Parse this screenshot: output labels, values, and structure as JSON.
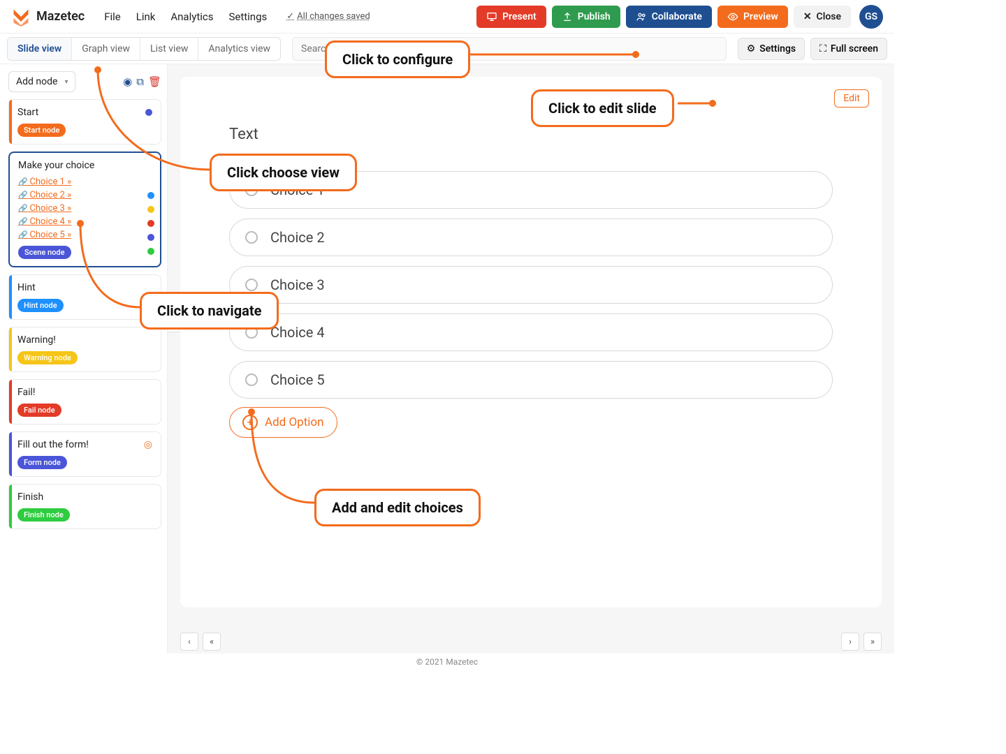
{
  "brand": "Mazetec",
  "menu": {
    "file": "File",
    "link": "Link",
    "analytics": "Analytics",
    "settings": "Settings"
  },
  "saved": "All changes saved",
  "header_buttons": {
    "present": "Present",
    "publish": "Publish",
    "collaborate": "Collaborate",
    "preview": "Preview",
    "close": "Close"
  },
  "avatar_initials": "GS",
  "view_tabs": {
    "slide": "Slide view",
    "graph": "Graph view",
    "list": "List view",
    "analytics": "Analytics view"
  },
  "search_placeholder": "Search",
  "subbar": {
    "settings": "Settings",
    "fullscreen": "Full screen"
  },
  "add_node": "Add node",
  "nodes": {
    "start": {
      "title": "Start",
      "badge": "Start node",
      "badge_bg": "#f36b1c",
      "bar": "#f36b1c",
      "dot": "#4a55d8"
    },
    "choice": {
      "title": "Make your choice",
      "badge": "Scene node",
      "badge_bg": "#4a55d8",
      "choices": [
        "Choice 1",
        "Choice 2",
        "Choice 3",
        "Choice 4",
        "Choice 5"
      ],
      "dots": [
        "#1e90ff",
        "#f5c518",
        "#e33b27",
        "#4a55d8",
        "#2ecc40"
      ]
    },
    "hint": {
      "title": "Hint",
      "badge": "Hint node",
      "badge_bg": "#1e90ff",
      "bar": "#1e90ff"
    },
    "warning": {
      "title": "Warning!",
      "badge": "Warning node",
      "badge_bg": "#f5c518",
      "bar": "#f5c518"
    },
    "fail": {
      "title": "Fail!",
      "badge": "Fail node",
      "badge_bg": "#e33b27",
      "bar": "#e33b27"
    },
    "form": {
      "title": "Fill out the form!",
      "badge": "Form node",
      "badge_bg": "#4a55d8",
      "bar": "#4a55d8"
    },
    "finish": {
      "title": "Finish",
      "badge": "Finish node",
      "badge_bg": "#2ecc40",
      "bar": "#2ecc40"
    }
  },
  "slide": {
    "edit": "Edit",
    "text_label": "Text",
    "options": [
      "Choice 1",
      "Choice 2",
      "Choice 3",
      "Choice 4",
      "Choice 5"
    ],
    "add_option": "Add Option"
  },
  "callouts": {
    "configure": "Click to configure",
    "edit_slide": "Click to edit slide",
    "choose_view": "Click choose view",
    "navigate": "Click to navigate",
    "add_edit": "Add and edit choices"
  },
  "footer": "© 2021 Mazetec"
}
